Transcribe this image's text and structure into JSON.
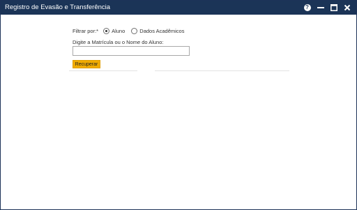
{
  "window": {
    "title": "Registro de Evasão e Transferência",
    "controls": {
      "help_glyph": "?",
      "help_icon": "help-icon",
      "minimize_icon": "minimize-icon",
      "maximize_icon": "maximize-icon",
      "close_icon": "close-icon"
    }
  },
  "form": {
    "filter_label": "Filtrar por:*",
    "filter_options": [
      {
        "label": "Aluno",
        "selected": true
      },
      {
        "label": "Dados Acadêmicos",
        "selected": false
      }
    ],
    "search_label": "Digite a Matrícula ou o Nome do Aluno:",
    "search_value": "",
    "search_placeholder": "",
    "submit_label": "Recuperar"
  },
  "colors": {
    "titlebar": "#1b3457",
    "button": "#f0ab00"
  }
}
